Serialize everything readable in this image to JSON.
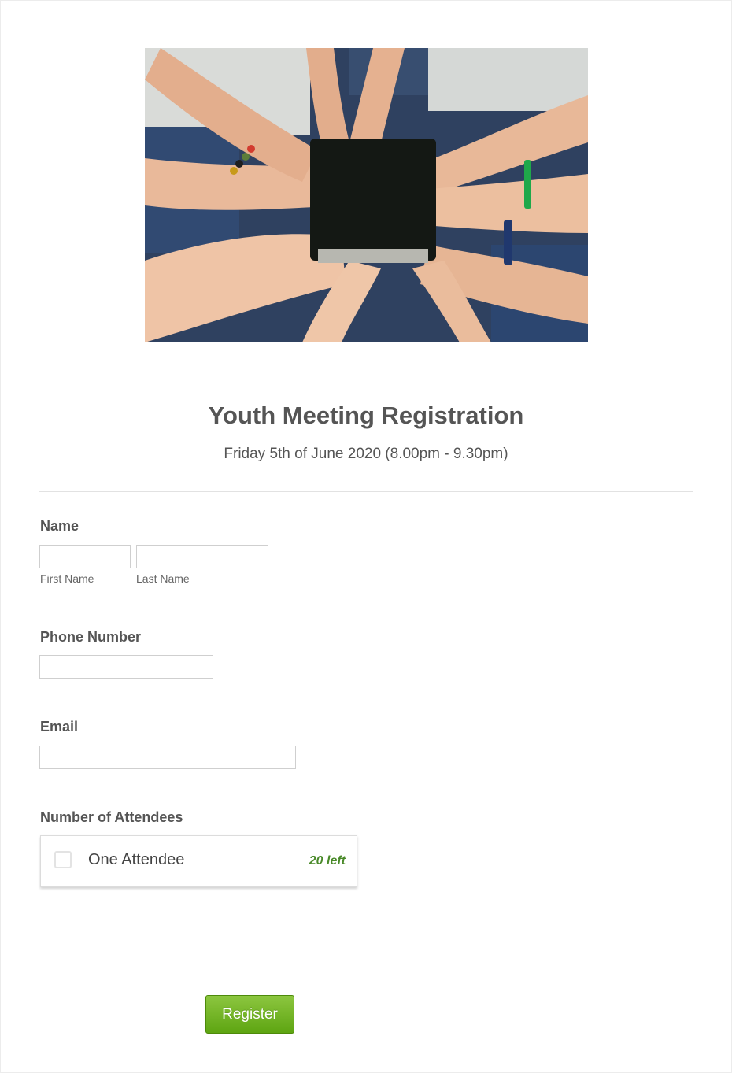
{
  "hero": {
    "image_description_icon": "photo-hands-on-bible"
  },
  "header": {
    "title": "Youth Meeting Registration",
    "subtitle": "Friday 5th of June 2020 (8.00pm - 9.30pm)"
  },
  "form": {
    "name": {
      "label": "Name",
      "first_value": "",
      "first_sublabel": "First Name",
      "last_value": "",
      "last_sublabel": "Last Name"
    },
    "phone": {
      "label": "Phone Number",
      "value": ""
    },
    "email": {
      "label": "Email",
      "value": ""
    },
    "attendees": {
      "label": "Number of Attendees",
      "option_name": "One Attendee",
      "option_stock": "20 left",
      "checked": false
    },
    "submit_label": "Register"
  },
  "colors": {
    "accent_green": "#6fb521",
    "stock_green": "#4a8a2a",
    "text": "#555555"
  }
}
